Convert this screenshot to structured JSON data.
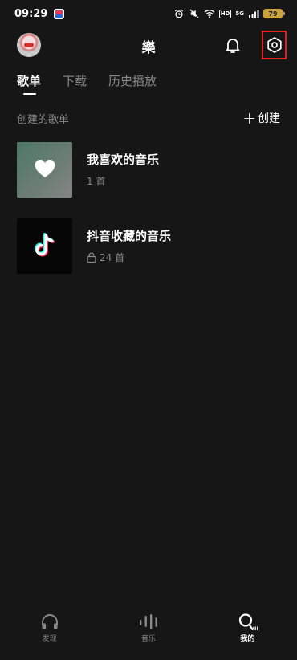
{
  "status_bar": {
    "time": "09:29",
    "network_badge": "HD",
    "signal_text": "5G",
    "battery": "79"
  },
  "header": {
    "title": "樂",
    "icons": [
      "avatar",
      "bell-icon",
      "settings-icon"
    ]
  },
  "tabs": [
    {
      "label": "歌单",
      "active": true
    },
    {
      "label": "下载",
      "active": false
    },
    {
      "label": "历史播放",
      "active": false
    }
  ],
  "section": {
    "title": "创建的歌单",
    "create_label": "创建"
  },
  "playlists": [
    {
      "name": "我喜欢的音乐",
      "count": "1 首",
      "cover": "heart-icon"
    },
    {
      "name": "抖音收藏的音乐",
      "count": "24 首",
      "cover": "douyin-logo",
      "locked": true
    }
  ],
  "bottom_nav": [
    {
      "label": "发现",
      "icon": "headphones-icon",
      "active": false
    },
    {
      "label": "音乐",
      "icon": "waveform-icon",
      "active": false
    },
    {
      "label": "我的",
      "icon": "profile-vip-icon",
      "active": true
    }
  ],
  "colors": {
    "background": "#161616",
    "highlight_border": "#e02020",
    "muted_text": "#8a8a8a"
  }
}
